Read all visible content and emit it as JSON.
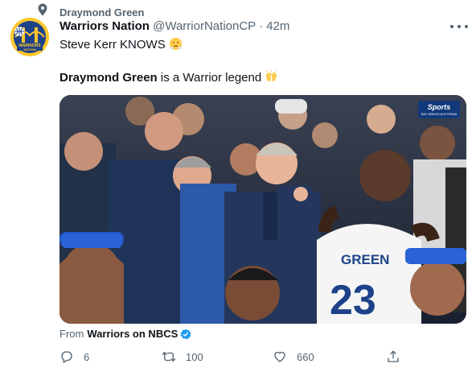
{
  "retweet_context": {
    "label": "Draymond Green",
    "icon": "location-pin-icon"
  },
  "author": {
    "name": "Warriors Nation",
    "handle": "@WarriorNationCP",
    "separator": "·",
    "time": "42m",
    "avatar_text_top": "WARRIORS",
    "avatar_text_bottom": "NATION"
  },
  "tweet": {
    "line1_text": "Steve Kerr KNOWS",
    "line1_emoji": "face-with-steam-from-nose",
    "line2_bold": "Draymond Green",
    "line2_text": " is a Warrior legend",
    "line2_emoji": "raising-hands"
  },
  "media": {
    "network_logo_top": "Sports",
    "network_logo_bottom": "BAY AREA/CALIFORNIA",
    "jersey_name": "GREEN",
    "jersey_number": "23"
  },
  "source": {
    "prefix": "From",
    "name": "Warriors on NBCS",
    "verified": true
  },
  "actions": {
    "replies": "6",
    "retweets": "100",
    "likes": "660"
  },
  "colors": {
    "text": "#0f1419",
    "secondary": "#536471",
    "verified": "#1d9bf0",
    "avatar_bg": "#ffc72c",
    "warriors_blue": "#1d428a"
  }
}
